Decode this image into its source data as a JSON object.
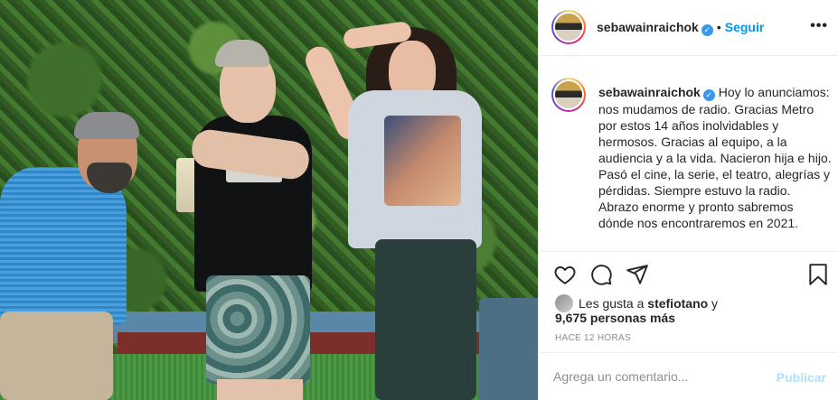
{
  "post": {
    "username": "sebawainraichok",
    "follow_label": "Seguir",
    "dot": "•",
    "more_label": "•••",
    "verified_mark": "✓",
    "caption": "Hoy lo anunciamos: nos mudamos de radio. Gracias Metro por estos 14 años inolvidables y hermosos. Gracias al equipo, a la audiencia y a la vida. Nacieron hija e hijo. Pasó el cine, la serie, el teatro, alegrías y pérdidas. Siempre estuvo la radio. Abrazo enorme y pronto sabremos dónde nos encontraremos en 2021.",
    "likes_prefix": "Les gusta a ",
    "likes_user": "stefiotano",
    "likes_suffix": " y",
    "likes_count_line": "9,675 personas más",
    "time_ago": "HACE 12 HORAS",
    "comment_placeholder": "Agrega un comentario...",
    "publish_label": "Publicar"
  },
  "icons": {
    "like": "heart-icon",
    "comment": "comment-icon",
    "share": "share-icon",
    "save": "bookmark-icon",
    "verified": "verified-badge-icon",
    "more": "more-options-icon"
  },
  "colors": {
    "accent": "#0095f6",
    "verified": "#3897f0",
    "publish_disabled": "#b2dffc",
    "muted": "#8e8e8e"
  }
}
